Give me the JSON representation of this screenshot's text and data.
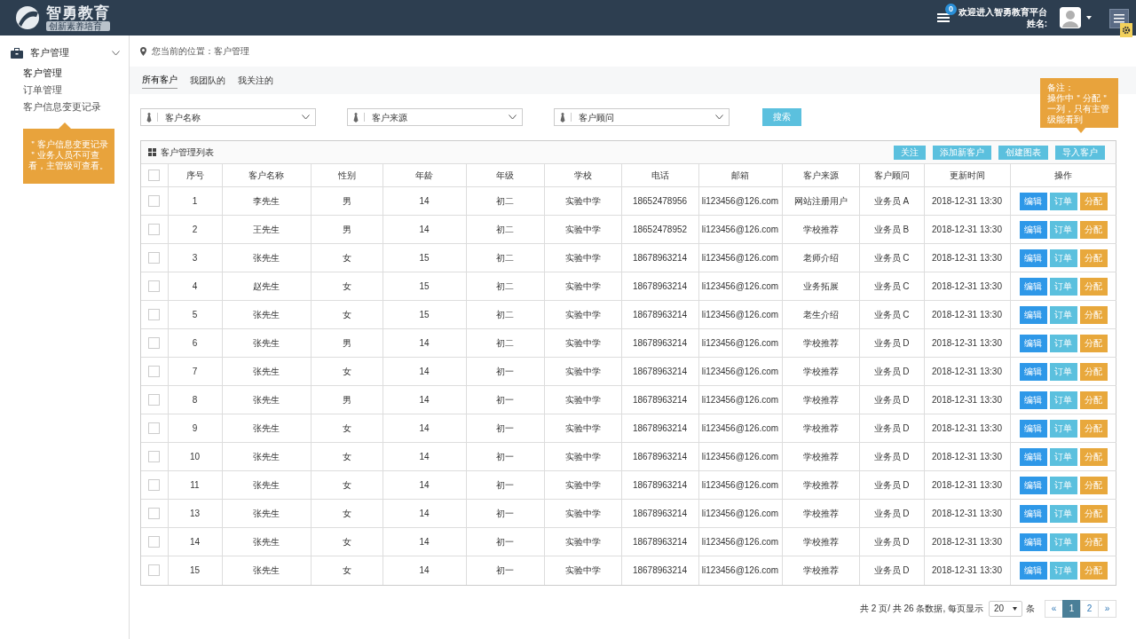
{
  "header": {
    "logo_title": "智勇教育",
    "logo_subtitle": "创新素养培育",
    "message_count": "0",
    "welcome": "欢迎进入智勇教育平台",
    "user_label": "姓名:"
  },
  "sidebar": {
    "group": {
      "label": "客户管理",
      "expanded": true
    },
    "items": [
      {
        "label": "客户管理",
        "selected": true
      },
      {
        "label": "订单管理",
        "selected": false
      },
      {
        "label": "客户信息变更记录",
        "selected": false
      }
    ],
    "note": "＂客户信息变更记录＂业务人员不可查看，主管级可查看。"
  },
  "breadcrumb": "您当前的位置：客户管理",
  "tabs": [
    {
      "label": "所有客户",
      "selected": true
    },
    {
      "label": "我团队的",
      "selected": false
    },
    {
      "label": "我关注的",
      "selected": false
    }
  ],
  "filters": [
    {
      "placeholder": "客户名称"
    },
    {
      "placeholder": "客户来源"
    },
    {
      "placeholder": "客户顾问"
    }
  ],
  "search_button": "搜索",
  "note": {
    "title": "备注：",
    "text": "操作中＂分配＂一列，只有主管级能看到"
  },
  "panel": {
    "title": "客户管理列表",
    "buttons": [
      "关注",
      "添加新客户",
      "创建图表",
      "导入客户"
    ]
  },
  "table": {
    "header_checked": false,
    "columns": [
      "序号",
      "客户名称",
      "性别",
      "年龄",
      "年级",
      "学校",
      "电话",
      "邮箱",
      "客户来源",
      "客户顾问",
      "更新时间",
      "操作"
    ],
    "rows": [
      {
        "checked": false,
        "cells": [
          "1",
          "李先生",
          "男",
          "14",
          "初二",
          "实验中学",
          "18652478956",
          "li123456@126.com",
          "网站注册用户",
          "业务员 A",
          "2018-12-31 13:30"
        ],
        "actions": [
          {
            "label": "编辑",
            "kind": "edit"
          },
          {
            "label": "订单",
            "kind": "order"
          },
          {
            "label": "分配",
            "kind": "assign"
          }
        ]
      },
      {
        "checked": false,
        "cells": [
          "2",
          "王先生",
          "男",
          "14",
          "初二",
          "实验中学",
          "18652478952",
          "li123456@126.com",
          "学校推荐",
          "业务员 B",
          "2018-12-31 13:30"
        ],
        "actions": [
          {
            "label": "编辑",
            "kind": "edit"
          },
          {
            "label": "订单",
            "kind": "order"
          },
          {
            "label": "分配",
            "kind": "assign"
          }
        ]
      },
      {
        "checked": false,
        "cells": [
          "3",
          "张先生",
          "女",
          "15",
          "初二",
          "实验中学",
          "18678963214",
          "li123456@126.com",
          "老师介绍",
          "业务员 C",
          "2018-12-31 13:30"
        ],
        "actions": [
          {
            "label": "编辑",
            "kind": "edit"
          },
          {
            "label": "订单",
            "kind": "order"
          },
          {
            "label": "分配",
            "kind": "assign"
          }
        ]
      },
      {
        "checked": false,
        "cells": [
          "4",
          "赵先生",
          "女",
          "15",
          "初二",
          "实验中学",
          "18678963214",
          "li123456@126.com",
          "业务拓展",
          "业务员 C",
          "2018-12-31 13:30"
        ],
        "actions": [
          {
            "label": "编辑",
            "kind": "edit"
          },
          {
            "label": "订单",
            "kind": "order"
          },
          {
            "label": "分配",
            "kind": "assign"
          }
        ]
      },
      {
        "checked": false,
        "cells": [
          "5",
          "张先生",
          "女",
          "15",
          "初二",
          "实验中学",
          "18678963214",
          "li123456@126.com",
          "老生介绍",
          "业务员 C",
          "2018-12-31 13:30"
        ],
        "actions": [
          {
            "label": "编辑",
            "kind": "edit"
          },
          {
            "label": "订单",
            "kind": "order"
          },
          {
            "label": "分配",
            "kind": "assign"
          }
        ]
      },
      {
        "checked": false,
        "cells": [
          "6",
          "张先生",
          "男",
          "14",
          "初二",
          "实验中学",
          "18678963214",
          "li123456@126.com",
          "学校推荐",
          "业务员 D",
          "2018-12-31 13:30"
        ],
        "actions": [
          {
            "label": "编辑",
            "kind": "edit"
          },
          {
            "label": "订单",
            "kind": "order"
          },
          {
            "label": "分配",
            "kind": "assign"
          }
        ]
      },
      {
        "checked": false,
        "cells": [
          "7",
          "张先生",
          "女",
          "14",
          "初一",
          "实验中学",
          "18678963214",
          "li123456@126.com",
          "学校推荐",
          "业务员 D",
          "2018-12-31 13:30"
        ],
        "actions": [
          {
            "label": "编辑",
            "kind": "edit"
          },
          {
            "label": "订单",
            "kind": "order"
          },
          {
            "label": "分配",
            "kind": "assign"
          }
        ]
      },
      {
        "checked": false,
        "cells": [
          "8",
          "张先生",
          "男",
          "14",
          "初一",
          "实验中学",
          "18678963214",
          "li123456@126.com",
          "学校推荐",
          "业务员 D",
          "2018-12-31 13:30"
        ],
        "actions": [
          {
            "label": "编辑",
            "kind": "edit"
          },
          {
            "label": "订单",
            "kind": "order"
          },
          {
            "label": "分配",
            "kind": "assign"
          }
        ]
      },
      {
        "checked": false,
        "cells": [
          "9",
          "张先生",
          "女",
          "14",
          "初一",
          "实验中学",
          "18678963214",
          "li123456@126.com",
          "学校推荐",
          "业务员 D",
          "2018-12-31 13:30"
        ],
        "actions": [
          {
            "label": "编辑",
            "kind": "edit"
          },
          {
            "label": "订单",
            "kind": "order"
          },
          {
            "label": "分配",
            "kind": "assign"
          }
        ]
      },
      {
        "checked": false,
        "cells": [
          "10",
          "张先生",
          "女",
          "14",
          "初一",
          "实验中学",
          "18678963214",
          "li123456@126.com",
          "学校推荐",
          "业务员 D",
          "2018-12-31 13:30"
        ],
        "actions": [
          {
            "label": "编辑",
            "kind": "edit"
          },
          {
            "label": "订单",
            "kind": "order"
          },
          {
            "label": "分配",
            "kind": "assign"
          }
        ]
      },
      {
        "checked": false,
        "cells": [
          "11",
          "张先生",
          "女",
          "14",
          "初一",
          "实验中学",
          "18678963214",
          "li123456@126.com",
          "学校推荐",
          "业务员 D",
          "2018-12-31 13:30"
        ],
        "actions": [
          {
            "label": "编辑",
            "kind": "edit"
          },
          {
            "label": "订单",
            "kind": "order"
          },
          {
            "label": "分配",
            "kind": "assign"
          }
        ]
      },
      {
        "checked": false,
        "cells": [
          "13",
          "张先生",
          "女",
          "14",
          "初一",
          "实验中学",
          "18678963214",
          "li123456@126.com",
          "学校推荐",
          "业务员 D",
          "2018-12-31 13:30"
        ],
        "actions": [
          {
            "label": "编辑",
            "kind": "edit"
          },
          {
            "label": "订单",
            "kind": "order"
          },
          {
            "label": "分配",
            "kind": "assign"
          }
        ]
      },
      {
        "checked": false,
        "cells": [
          "14",
          "张先生",
          "女",
          "14",
          "初一",
          "实验中学",
          "18678963214",
          "li123456@126.com",
          "学校推荐",
          "业务员 D",
          "2018-12-31 13:30"
        ],
        "actions": [
          {
            "label": "编辑",
            "kind": "edit"
          },
          {
            "label": "订单",
            "kind": "order"
          },
          {
            "label": "分配",
            "kind": "assign"
          }
        ]
      },
      {
        "checked": false,
        "cells": [
          "15",
          "张先生",
          "女",
          "14",
          "初一",
          "实验中学",
          "18678963214",
          "li123456@126.com",
          "学校推荐",
          "业务员 D",
          "2018-12-31 13:30"
        ],
        "actions": [
          {
            "label": "编辑",
            "kind": "edit"
          },
          {
            "label": "订单",
            "kind": "order"
          },
          {
            "label": "分配",
            "kind": "assign"
          }
        ]
      }
    ]
  },
  "pagination": {
    "summary": "共 2 页/ 共 26 条数据, 每页显示",
    "page_size": "20",
    "unit": "条",
    "prev": "«",
    "pages": [
      {
        "label": "1",
        "selected": true
      },
      {
        "label": "2",
        "selected": false
      }
    ],
    "next": "»"
  }
}
